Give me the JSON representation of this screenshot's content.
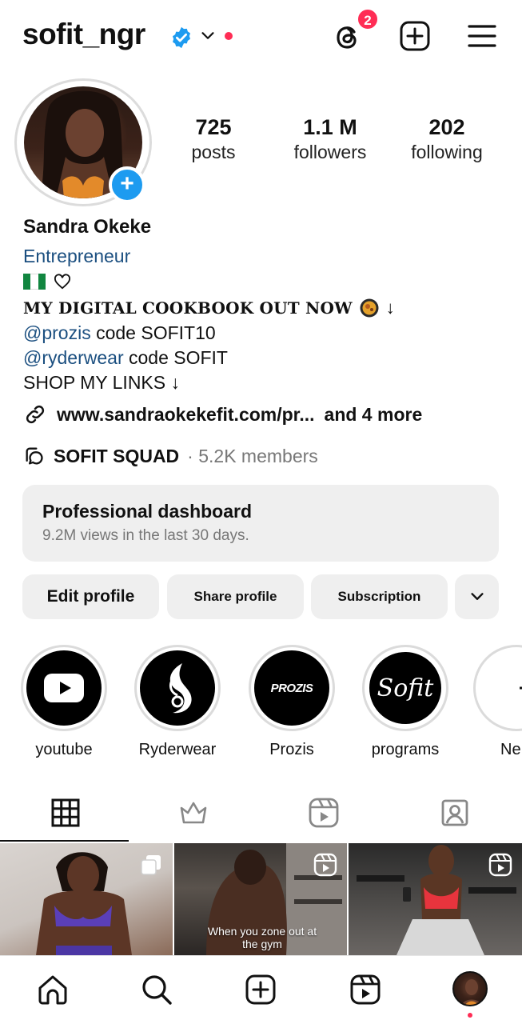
{
  "header": {
    "username": "sofit_ngr",
    "notification_count": "2"
  },
  "profile": {
    "stats": [
      {
        "value": "725",
        "label": "posts"
      },
      {
        "value": "1.1 M",
        "label": "followers"
      },
      {
        "value": "202",
        "label": "following"
      }
    ],
    "name": "Sandra Okeke",
    "category": "Entrepreneur",
    "bio": {
      "line1": "MY DIGITAL COOKBOOK OUT NOW",
      "line1_arrow": "↓",
      "prozis_mention": "@prozis",
      "prozis_code": " code SOFIT10",
      "ryder_mention": "@ryderwear",
      "ryder_code": " code SOFIT",
      "shop": "SHOP MY LINKS ↓"
    },
    "link": {
      "url": "www.sandraokekefit.com/pr...",
      "more": "and 4 more"
    },
    "community": {
      "name": "SOFIT SQUAD",
      "meta": "· 5.2K members"
    }
  },
  "dashboard": {
    "title": "Professional dashboard",
    "subtitle": "9.2M views in the last 30 days."
  },
  "buttons": {
    "edit": "Edit profile",
    "share": "Share profile",
    "subscription": "Subscription"
  },
  "highlights": [
    {
      "label": "youtube",
      "icon": "youtube-icon"
    },
    {
      "label": "Ryderwear",
      "icon": "ryderwear-logo"
    },
    {
      "label": "Prozis",
      "icon": "prozis-logo",
      "logo_text": "PROZIS"
    },
    {
      "label": "programs",
      "icon": "sofit-logo",
      "logo_text": "Sofit"
    },
    {
      "label": "Ne",
      "icon": "plus-icon"
    }
  ],
  "tabs": [
    "grid-icon",
    "crown-icon",
    "reels-icon",
    "tagged-icon"
  ],
  "posts": [
    {
      "type": "carousel"
    },
    {
      "type": "reel",
      "caption": "When you zone out at the gym"
    },
    {
      "type": "reel"
    }
  ],
  "colors": {
    "accent_blue": "#1d9bf0",
    "badge_red": "#ff2d55",
    "link_blue": "#1b4f80",
    "button_bg": "#efefef"
  }
}
